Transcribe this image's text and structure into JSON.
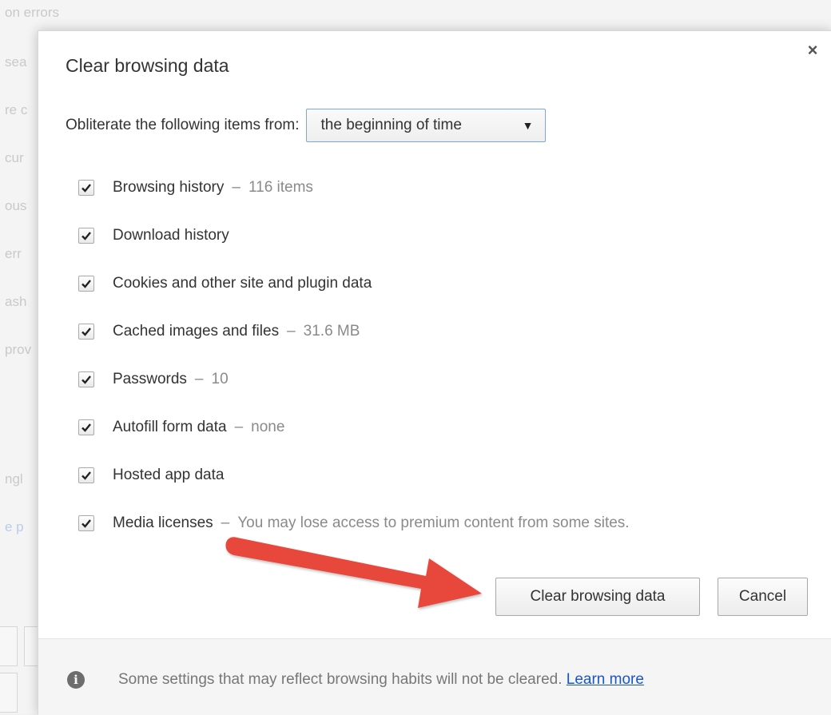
{
  "background": {
    "lines": [
      {
        "text": "on errors",
        "blue": false
      },
      {
        "text": "sea",
        "blue": false
      },
      {
        "text": "re c",
        "blue": false
      },
      {
        "text": "cur",
        "blue": false
      },
      {
        "text": "ous",
        "blue": false
      },
      {
        "text": "err",
        "blue": false
      },
      {
        "text": "ash",
        "blue": false
      },
      {
        "text": "prov",
        "blue": false
      },
      {
        "text": "ngl",
        "blue": false
      },
      {
        "text": "e p",
        "blue": true
      }
    ]
  },
  "dialog": {
    "title": "Clear browsing data",
    "close_label": "×",
    "from_label": "Obliterate the following items from:",
    "time_range": {
      "selected": "the beginning of time",
      "arrow": "▼"
    },
    "items": [
      {
        "label": "Browsing history",
        "detail": "116 items",
        "checked": true
      },
      {
        "label": "Download history",
        "detail": "",
        "checked": true
      },
      {
        "label": "Cookies and other site and plugin data",
        "detail": "",
        "checked": true
      },
      {
        "label": "Cached images and files",
        "detail": "31.6 MB",
        "checked": true
      },
      {
        "label": "Passwords",
        "detail": "10",
        "checked": true
      },
      {
        "label": "Autofill form data",
        "detail": "none",
        "checked": true
      },
      {
        "label": "Hosted app data",
        "detail": "",
        "checked": true
      },
      {
        "label": "Media licenses",
        "detail": "You may lose access to premium content from some sites.",
        "checked": true
      }
    ],
    "dash": "–",
    "buttons": {
      "clear": "Clear browsing data",
      "cancel": "Cancel"
    },
    "footer": {
      "info_icon": "info-icon",
      "text": "Some settings that may reflect browsing habits will not be cleared.",
      "link": "Learn more"
    }
  },
  "colors": {
    "annotation_arrow": "#e8463a",
    "link": "#1a56c8",
    "select_border": "#7aa7e0"
  }
}
